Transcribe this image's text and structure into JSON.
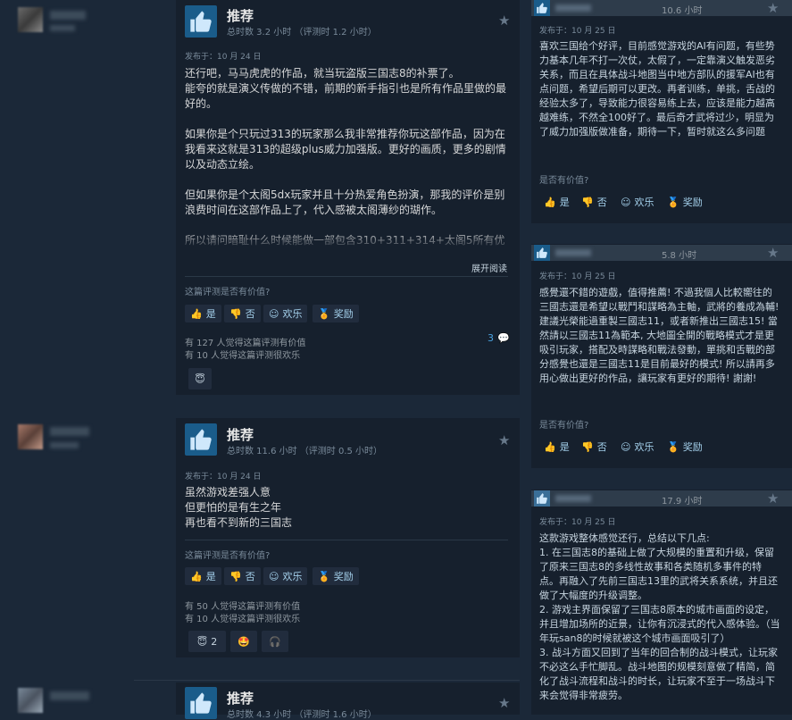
{
  "common": {
    "recommended": "推荐",
    "star": "★",
    "helpful_question": "这篇评测是否有价值?",
    "helpful_question_short": "是否有价值?",
    "yes": "是",
    "no": "否",
    "funny": "欢乐",
    "award": "奖励",
    "expand": "展开阅读"
  },
  "reviews_left": [
    {
      "hours": "总时数 3.2 小时  （评测时 1.2 小时）",
      "posted": "发布于：10 月 24 日",
      "body": "还行吧，马马虎虎的作品，就当玩盗版三国志8的补票了。\n能夸的就是演义传做的不错，前期的新手指引也是所有作品里做的最好的。\n\n如果你是个只玩过313的玩家那么我非常推荐你玩这部作品，因为在我看来这就是313的超级plus威力加强版。更好的画质，更多的剧情以及动态立绘。\n\n但如果你是个太阁5dx玩家并且十分热爱角色扮演，那我的评价是别浪费时间在这部作品上了，代入感被太阁薄纱的瑚作。\n\n所以请问暗耻什么时候能做一部包含310+311+314+太阁5所有优点的作品？",
      "helpful_count": "有 127 人觉得这篇评测有价值",
      "funny_count": "有 10 人觉得这篇评测很欢乐",
      "comments": "3",
      "awards": [
        {
          "icon": "😇",
          "count": ""
        }
      ]
    },
    {
      "hours": "总时数 11.6 小时  （评测时 0.5 小时）",
      "posted": "发布于：10 月 24 日",
      "body": "虽然游戏差强人意\n但更怕的是有生之年\n再也看不到新的三国志",
      "helpful_count": "有 50 人觉得这篇评测有价值",
      "funny_count": "有 10 人觉得这篇评测很欢乐",
      "awards": [
        {
          "icon": "😇",
          "count": "2"
        },
        {
          "icon": "🤩",
          "count": ""
        },
        {
          "icon": "🎧",
          "count": ""
        }
      ]
    },
    {
      "hours": "总时数 4.3 小时  （评测时 1.6 小时）"
    }
  ],
  "reviews_right": [
    {
      "hours": "10.6 小时",
      "posted": "发布于：10 月 25 日",
      "body": "喜欢三国给个好评，目前感觉游戏的AI有问题，有些势力基本几年不打一次仗，太假了，一定靠演义触发恶劣关系，而且在具体战斗地图当中地方部队的援军AI也有点问题，希望后期可以更改。再者训练，单挑，舌战的经验太多了，导致能力很容易练上去，应该是能力越高越难练，不然全100好了。最后奇才武将过少，明显为了威力加强版做准备，期待一下，暂时就这么多问题"
    },
    {
      "hours": "5.8 小时",
      "posted": "发布于：10 月 25 日",
      "body": "感覺還不錯的遊戲，值得推薦! 不過我個人比較嚮往的三國志還是希望以戰鬥和謀略為主軸，武將的養成為輔! 建議光榮能過重製三國志11，或者新推出三國志15! 當然請以三國志11為範本, 大地圖全開的戰略模式才是更吸引玩家，搭配及時謀略和戰法發動，單挑和舌戰的部分感覺也還是三國志11是目前最好的模式! 所以請再多用心做出更好的作品，讓玩家有更好的期待! 謝謝!"
    },
    {
      "hours": "17.9 小时",
      "posted": "发布于：10 月 25 日",
      "body": "这款游戏整体感觉还行，总结以下几点:\n1. 在三国志8的基础上做了大规模的重置和升级，保留了原来三国志8的多线性故事和各类随机多事件的特点。再融入了先前三国志13里的武将关系系统，并且还做了大幅度的升级调整。\n2. 游戏主界面保留了三国志8原本的城市画面的设定，并且增加场所的近景，让你有沉浸式的代入感体验。（当年玩san8的时候就被这个城市画面吸引了）\n3. 战斗方面又回到了当年的回合制的战斗模式，让玩家不必这么手忙脚乱。战斗地图的规模刻意做了精简，简化了战斗流程和战斗的时长，让玩家不至于一场战斗下来会觉得非常疲劳。"
    }
  ],
  "colors": {
    "page_bg": "#1b2838",
    "card_bg": "#16202d",
    "thumb_bg": "#1a5c8a",
    "link": "#4aa3e0"
  }
}
